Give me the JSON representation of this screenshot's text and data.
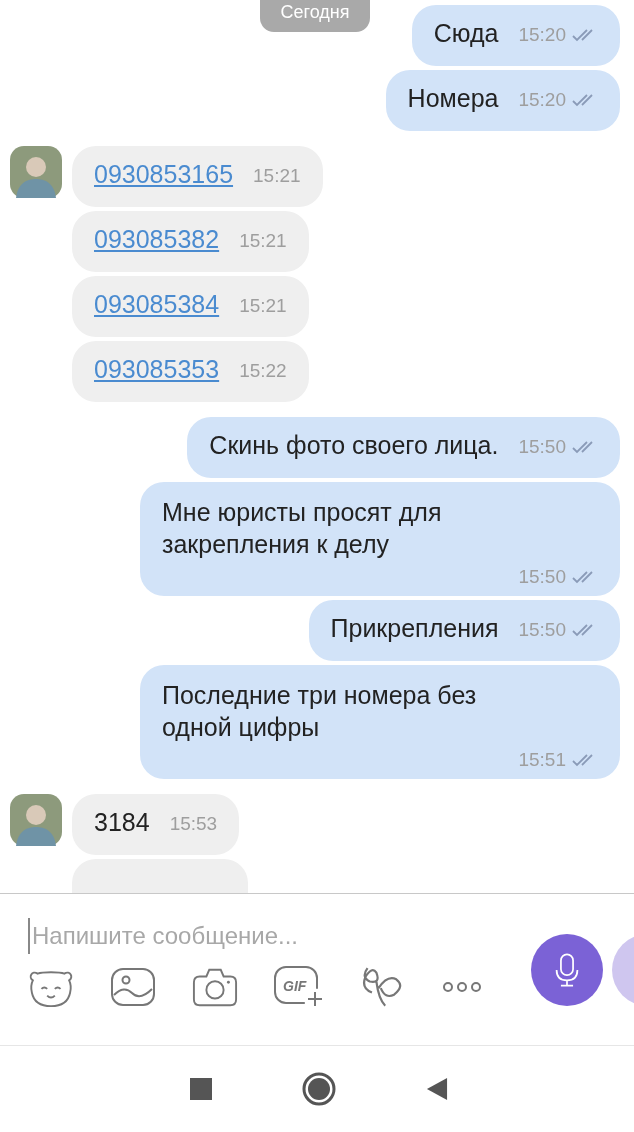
{
  "date_badge": "Сегодня",
  "messages": [
    {
      "outgoing": true,
      "kind": "text",
      "text": "Сюда",
      "time": "15:20"
    },
    {
      "outgoing": true,
      "kind": "text",
      "text": "Номера",
      "time": "15:20"
    },
    {
      "outgoing": false,
      "kind": "link",
      "text": "0930853165",
      "time": "15:21",
      "avatar": true
    },
    {
      "outgoing": false,
      "kind": "link",
      "text": "093085382",
      "time": "15:21"
    },
    {
      "outgoing": false,
      "kind": "link",
      "text": "093085384",
      "time": "15:21"
    },
    {
      "outgoing": false,
      "kind": "link",
      "text": "093085353",
      "time": "15:22"
    },
    {
      "outgoing": true,
      "kind": "text",
      "text": "Скинь фото своего лица.",
      "time": "15:50"
    },
    {
      "outgoing": true,
      "kind": "long",
      "text": "Мне юристы просят для закрепления к делу",
      "time": "15:50"
    },
    {
      "outgoing": true,
      "kind": "text",
      "text": "Прикрепления",
      "time": "15:50"
    },
    {
      "outgoing": true,
      "kind": "long",
      "text": "Последние три номера без одной цифры",
      "time": "15:51"
    },
    {
      "outgoing": false,
      "kind": "text",
      "text": "3184",
      "time": "15:53",
      "avatar": true
    },
    {
      "outgoing": false,
      "kind": "cut"
    }
  ],
  "composer": {
    "placeholder": "Напишите сообщение...",
    "tools": [
      {
        "kind": "sticker"
      },
      {
        "kind": "gallery"
      },
      {
        "kind": "camera"
      },
      {
        "kind": "gif",
        "label": "GIF"
      },
      {
        "kind": "doodle"
      },
      {
        "kind": "more"
      }
    ]
  },
  "nav": [
    {
      "kind": "recents"
    },
    {
      "kind": "home"
    },
    {
      "kind": "back"
    }
  ]
}
